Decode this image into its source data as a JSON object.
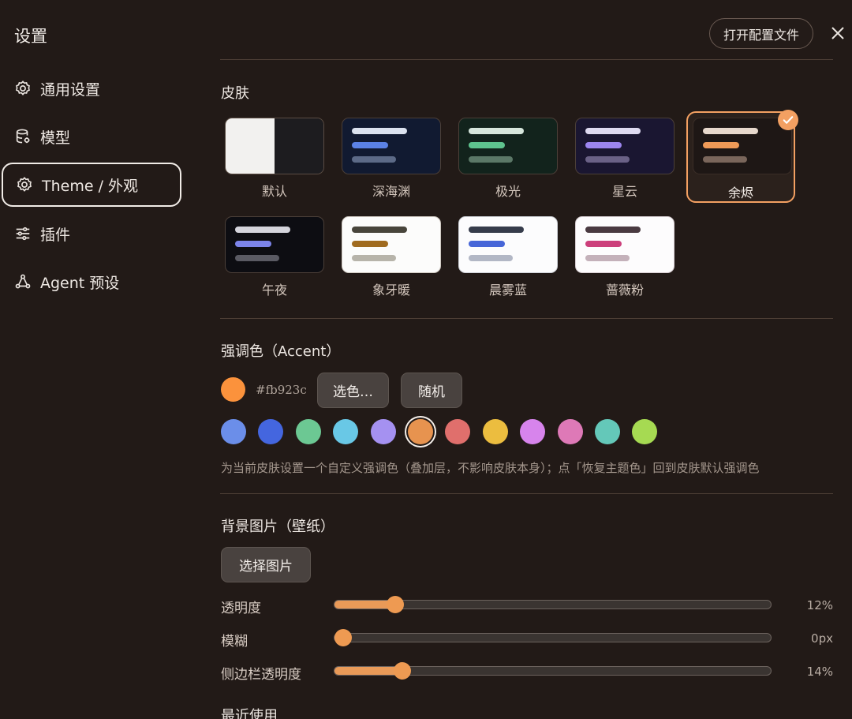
{
  "app_title": "设置",
  "sidebar": {
    "items": [
      {
        "label": "通用设置",
        "icon": "gear-icon"
      },
      {
        "label": "模型",
        "icon": "database-icon"
      },
      {
        "label": "Theme / 外观",
        "icon": "gear-icon"
      },
      {
        "label": "插件",
        "icon": "sliders-icon"
      },
      {
        "label": "Agent 预设",
        "icon": "nodes-icon"
      }
    ],
    "active_index": 2
  },
  "header": {
    "open_config_label": "打开配置文件",
    "close_icon": "close-icon"
  },
  "skins": {
    "title": "皮肤",
    "items": [
      {
        "name": "默认"
      },
      {
        "name": "深海渊"
      },
      {
        "name": "极光"
      },
      {
        "name": "星云"
      },
      {
        "name": "余烬",
        "selected": true
      },
      {
        "name": "午夜"
      },
      {
        "name": "象牙暖"
      },
      {
        "name": "晨雾蓝"
      },
      {
        "name": "蔷薇粉"
      }
    ]
  },
  "accent": {
    "title": "强调色（Accent）",
    "current_hex": "#fb923c",
    "pick_label": "选色…",
    "random_label": "随机",
    "swatches": [
      "#6b8ee9",
      "#4466df",
      "#6cc893",
      "#69c8e6",
      "#a591f1",
      "#e7934f",
      "#e06f6c",
      "#ecbd3f",
      "#d784ec",
      "#de79b7",
      "#64c8b9",
      "#a6da52"
    ],
    "selected_swatch": 5,
    "hint": "为当前皮肤设置一个自定义强调色（叠加层，不影响皮肤本身）；点「恢复主题色」回到皮肤默认强调色"
  },
  "background": {
    "title": "背景图片（壁纸）",
    "choose_label": "选择图片",
    "sliders": [
      {
        "label": "透明度",
        "value_text": "12%",
        "fraction": 0.14
      },
      {
        "label": "模糊",
        "value_text": "0px",
        "fraction": 0.02
      },
      {
        "label": "侧边栏透明度",
        "value_text": "14%",
        "fraction": 0.155
      }
    ]
  },
  "recent": {
    "title": "最近使用"
  }
}
